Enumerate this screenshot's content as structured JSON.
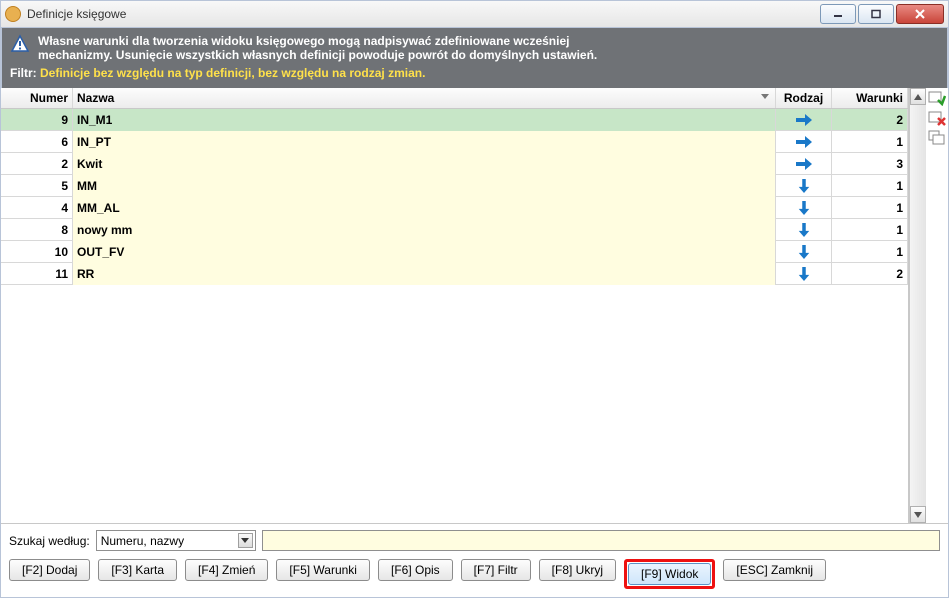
{
  "window": {
    "title": "Definicje księgowe"
  },
  "banner": {
    "line1": "Własne warunki dla tworzenia widoku księgowego mogą nadpisywać zdefiniowane wcześniej",
    "line2": "mechanizmy. Usunięcie wszystkich własnych definicji powoduje powrót do domyślnych ustawień.",
    "filter_label": "Filtr:",
    "filter_value": "Definicje bez względu na typ definicji, bez względu na rodzaj zmian."
  },
  "columns": {
    "numer": "Numer",
    "nazwa": "Nazwa",
    "rodzaj": "Rodzaj",
    "warunki": "Warunki"
  },
  "rows": [
    {
      "num": "9",
      "name": "IN_M1",
      "kind": "right",
      "war": "2",
      "selected": true
    },
    {
      "num": "6",
      "name": "IN_PT",
      "kind": "right",
      "war": "1",
      "selected": false
    },
    {
      "num": "2",
      "name": "Kwit",
      "kind": "right",
      "war": "3",
      "selected": false
    },
    {
      "num": "5",
      "name": "MM",
      "kind": "down",
      "war": "1",
      "selected": false
    },
    {
      "num": "4",
      "name": "MM_AL",
      "kind": "down",
      "war": "1",
      "selected": false
    },
    {
      "num": "8",
      "name": "nowy mm",
      "kind": "down",
      "war": "1",
      "selected": false
    },
    {
      "num": "10",
      "name": "OUT_FV",
      "kind": "down",
      "war": "1",
      "selected": false
    },
    {
      "num": "11",
      "name": "RR",
      "kind": "down",
      "war": "2",
      "selected": false
    }
  ],
  "search": {
    "label": "Szukaj według:",
    "combo_value": "Numeru, nazwy",
    "value": ""
  },
  "buttons": {
    "f2": "[F2] Dodaj",
    "f3": "[F3] Karta",
    "f4": "[F4] Zmień",
    "f5": "[F5] Warunki",
    "f6": "[F6] Opis",
    "f7": "[F7] Filtr",
    "f8": "[F8] Ukryj",
    "f9": "[F9] Widok",
    "esc": "[ESC] Zamknij"
  }
}
